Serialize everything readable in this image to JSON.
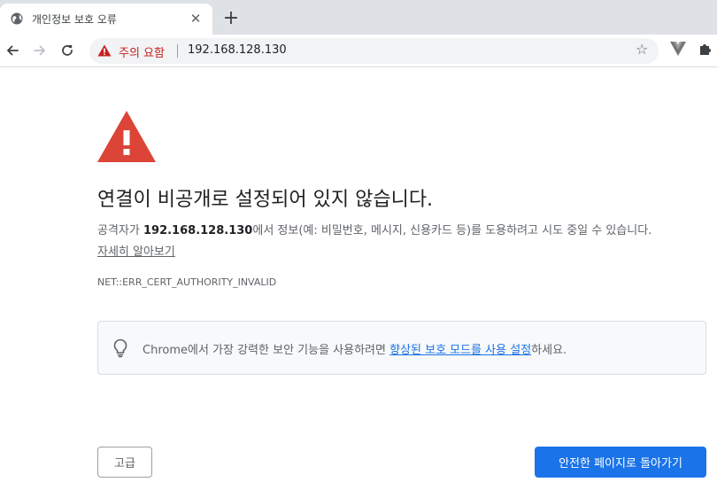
{
  "tab": {
    "title": "개인정보 보호 오류",
    "close_glyph": "✕",
    "new_tab_glyph": "+"
  },
  "toolbar": {
    "security_label": "주의 요함",
    "url": "192.168.128.130",
    "bookmark_glyph": "☆"
  },
  "page": {
    "heading": "연결이 비공개로 설정되어 있지 않습니다.",
    "description_prefix": "공격자가 ",
    "description_host": "192.168.128.130",
    "description_suffix": "에서 정보(예: 비밀번호, 메시지, 신용카드 등)를 도용하려고 시도 중일 수 있습니다.",
    "learn_more": "자세히 알아보기",
    "error_code": "NET::ERR_CERT_AUTHORITY_INVALID",
    "promo_prefix": "Chrome에서 가장 강력한 보안 기능을 사용하려면 ",
    "promo_link": "향상된 보호 모드를 사용 설정",
    "promo_suffix": "하세요.",
    "advanced_button": "고급",
    "back_button": "안전한 페이지로 돌아가기"
  },
  "colors": {
    "warning_red": "#db4437",
    "link_blue": "#1a73e8",
    "primary_button": "#1a73e8"
  },
  "icons": {
    "favicon": "globe-icon",
    "back": "back-arrow-icon",
    "forward": "forward-arrow-icon",
    "reload": "reload-icon",
    "security": "warning-triangle-icon",
    "bookmark": "star-icon",
    "extension1": "vue-devtools-icon",
    "extension2": "puzzle-icon",
    "promo": "lightbulb-icon",
    "hero": "warning-triangle-icon"
  }
}
